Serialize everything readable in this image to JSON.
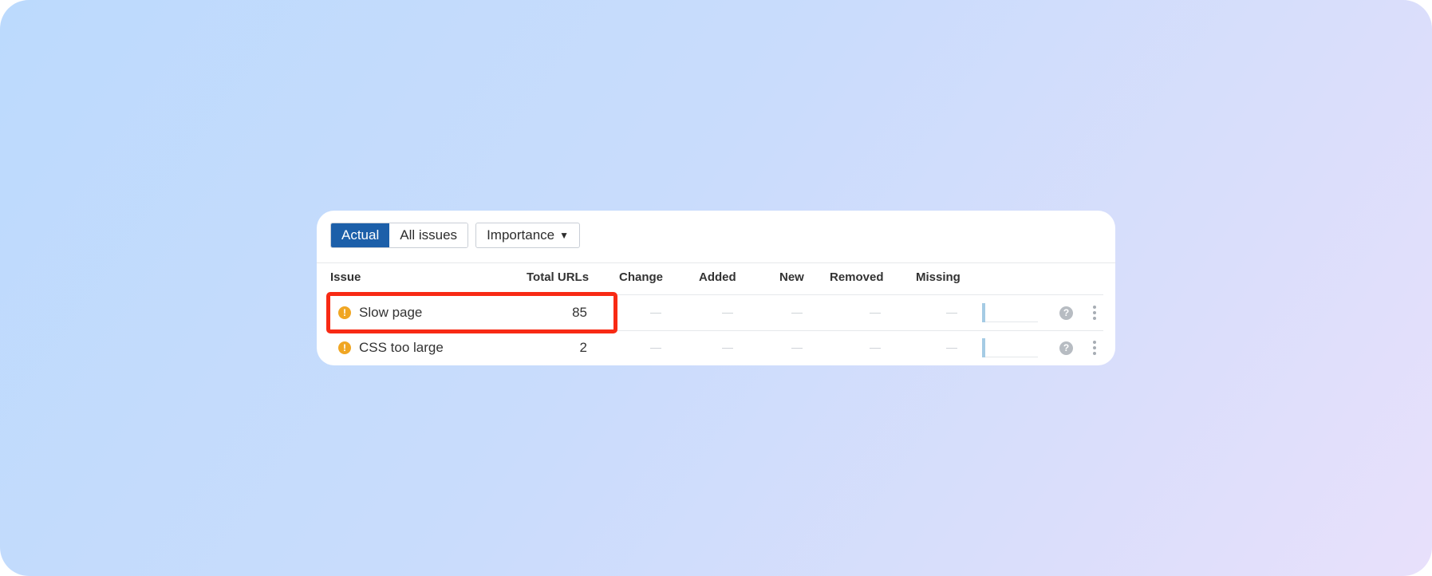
{
  "toolbar": {
    "tabs": [
      {
        "label": "Actual",
        "active": true
      },
      {
        "label": "All issues",
        "active": false
      }
    ],
    "dropdown_label": "Importance",
    "dropdown_caret": "▼"
  },
  "table": {
    "columns": [
      "Issue",
      "Total URLs",
      "Change",
      "Added",
      "New",
      "Removed",
      "Missing"
    ],
    "rows": [
      {
        "icon": "warning-icon",
        "issue": "Slow page",
        "total_urls": "85",
        "change": "—",
        "added": "—",
        "new": "—",
        "removed": "—",
        "missing": "—",
        "highlighted": true
      },
      {
        "icon": "warning-icon",
        "issue": "CSS too large",
        "total_urls": "2",
        "change": "—",
        "added": "—",
        "new": "—",
        "removed": "—",
        "missing": "—",
        "highlighted": false
      }
    ],
    "warning_glyph": "!",
    "help_glyph": "?"
  },
  "colors": {
    "accent": "#1c5fa9",
    "warning": "#f0a623",
    "highlight": "#f82a14",
    "sparkline": "#a5cbe4"
  }
}
